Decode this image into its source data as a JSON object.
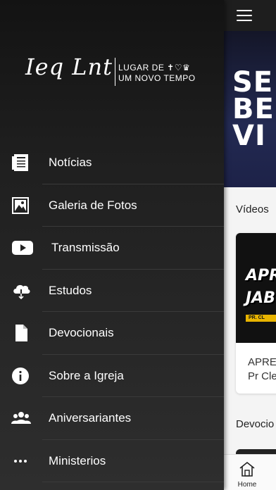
{
  "drawer": {
    "logo": {
      "script_text": "Ieq Lnt",
      "line1": "LUGAR DE ✝︎♡♛",
      "line2": "UM NOVO TEMPO"
    },
    "items": [
      {
        "label": "Notícias",
        "icon": "news-icon"
      },
      {
        "label": "Galeria de Fotos",
        "icon": "photo-gallery-icon"
      },
      {
        "label": "Transmissão",
        "icon": "youtube-play-icon"
      },
      {
        "label": "Estudos",
        "icon": "cloud-download-icon"
      },
      {
        "label": "Devocionais",
        "icon": "document-icon"
      },
      {
        "label": "Sobre a Igreja",
        "icon": "info-icon"
      },
      {
        "label": "Aniversariantes",
        "icon": "people-icon"
      },
      {
        "label": "Ministerios",
        "icon": "more-dots-icon"
      }
    ]
  },
  "content": {
    "banner_lines": [
      "SE",
      "BE",
      "VI"
    ],
    "videos_title": "Vídeos",
    "video_card": {
      "image_text_line1": "APR",
      "image_text_line2": "JAB",
      "image_strip": "PR. CL",
      "title_line1": "APRE",
      "title_line2": "Pr Cle"
    },
    "devotionals_title": "Devocio"
  },
  "tabbar": {
    "home_label": "Home"
  },
  "colors": {
    "drawer_bg": "#1c1c1c",
    "topbar": "#1e1e1e",
    "banner": "#232a52",
    "accent_strip": "#e8b400"
  }
}
